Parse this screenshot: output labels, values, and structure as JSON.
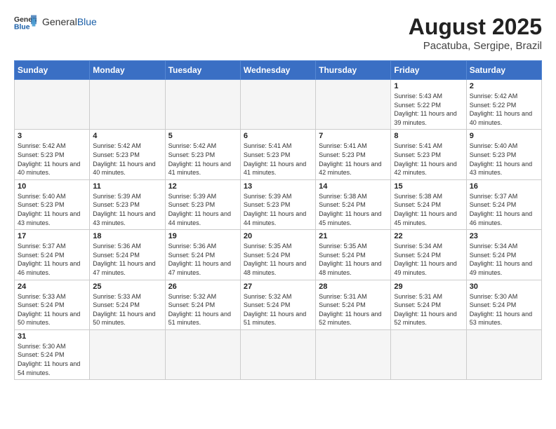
{
  "header": {
    "logo_general": "General",
    "logo_blue": "Blue",
    "title": "August 2025",
    "subtitle": "Pacatuba, Sergipe, Brazil"
  },
  "days_of_week": [
    "Sunday",
    "Monday",
    "Tuesday",
    "Wednesday",
    "Thursday",
    "Friday",
    "Saturday"
  ],
  "weeks": [
    [
      {
        "day": "",
        "info": ""
      },
      {
        "day": "",
        "info": ""
      },
      {
        "day": "",
        "info": ""
      },
      {
        "day": "",
        "info": ""
      },
      {
        "day": "",
        "info": ""
      },
      {
        "day": "1",
        "info": "Sunrise: 5:43 AM\nSunset: 5:22 PM\nDaylight: 11 hours and 39 minutes."
      },
      {
        "day": "2",
        "info": "Sunrise: 5:42 AM\nSunset: 5:22 PM\nDaylight: 11 hours and 40 minutes."
      }
    ],
    [
      {
        "day": "3",
        "info": "Sunrise: 5:42 AM\nSunset: 5:23 PM\nDaylight: 11 hours and 40 minutes."
      },
      {
        "day": "4",
        "info": "Sunrise: 5:42 AM\nSunset: 5:23 PM\nDaylight: 11 hours and 40 minutes."
      },
      {
        "day": "5",
        "info": "Sunrise: 5:42 AM\nSunset: 5:23 PM\nDaylight: 11 hours and 41 minutes."
      },
      {
        "day": "6",
        "info": "Sunrise: 5:41 AM\nSunset: 5:23 PM\nDaylight: 11 hours and 41 minutes."
      },
      {
        "day": "7",
        "info": "Sunrise: 5:41 AM\nSunset: 5:23 PM\nDaylight: 11 hours and 42 minutes."
      },
      {
        "day": "8",
        "info": "Sunrise: 5:41 AM\nSunset: 5:23 PM\nDaylight: 11 hours and 42 minutes."
      },
      {
        "day": "9",
        "info": "Sunrise: 5:40 AM\nSunset: 5:23 PM\nDaylight: 11 hours and 43 minutes."
      }
    ],
    [
      {
        "day": "10",
        "info": "Sunrise: 5:40 AM\nSunset: 5:23 PM\nDaylight: 11 hours and 43 minutes."
      },
      {
        "day": "11",
        "info": "Sunrise: 5:39 AM\nSunset: 5:23 PM\nDaylight: 11 hours and 43 minutes."
      },
      {
        "day": "12",
        "info": "Sunrise: 5:39 AM\nSunset: 5:23 PM\nDaylight: 11 hours and 44 minutes."
      },
      {
        "day": "13",
        "info": "Sunrise: 5:39 AM\nSunset: 5:23 PM\nDaylight: 11 hours and 44 minutes."
      },
      {
        "day": "14",
        "info": "Sunrise: 5:38 AM\nSunset: 5:24 PM\nDaylight: 11 hours and 45 minutes."
      },
      {
        "day": "15",
        "info": "Sunrise: 5:38 AM\nSunset: 5:24 PM\nDaylight: 11 hours and 45 minutes."
      },
      {
        "day": "16",
        "info": "Sunrise: 5:37 AM\nSunset: 5:24 PM\nDaylight: 11 hours and 46 minutes."
      }
    ],
    [
      {
        "day": "17",
        "info": "Sunrise: 5:37 AM\nSunset: 5:24 PM\nDaylight: 11 hours and 46 minutes."
      },
      {
        "day": "18",
        "info": "Sunrise: 5:36 AM\nSunset: 5:24 PM\nDaylight: 11 hours and 47 minutes."
      },
      {
        "day": "19",
        "info": "Sunrise: 5:36 AM\nSunset: 5:24 PM\nDaylight: 11 hours and 47 minutes."
      },
      {
        "day": "20",
        "info": "Sunrise: 5:35 AM\nSunset: 5:24 PM\nDaylight: 11 hours and 48 minutes."
      },
      {
        "day": "21",
        "info": "Sunrise: 5:35 AM\nSunset: 5:24 PM\nDaylight: 11 hours and 48 minutes."
      },
      {
        "day": "22",
        "info": "Sunrise: 5:34 AM\nSunset: 5:24 PM\nDaylight: 11 hours and 49 minutes."
      },
      {
        "day": "23",
        "info": "Sunrise: 5:34 AM\nSunset: 5:24 PM\nDaylight: 11 hours and 49 minutes."
      }
    ],
    [
      {
        "day": "24",
        "info": "Sunrise: 5:33 AM\nSunset: 5:24 PM\nDaylight: 11 hours and 50 minutes."
      },
      {
        "day": "25",
        "info": "Sunrise: 5:33 AM\nSunset: 5:24 PM\nDaylight: 11 hours and 50 minutes."
      },
      {
        "day": "26",
        "info": "Sunrise: 5:32 AM\nSunset: 5:24 PM\nDaylight: 11 hours and 51 minutes."
      },
      {
        "day": "27",
        "info": "Sunrise: 5:32 AM\nSunset: 5:24 PM\nDaylight: 11 hours and 51 minutes."
      },
      {
        "day": "28",
        "info": "Sunrise: 5:31 AM\nSunset: 5:24 PM\nDaylight: 11 hours and 52 minutes."
      },
      {
        "day": "29",
        "info": "Sunrise: 5:31 AM\nSunset: 5:24 PM\nDaylight: 11 hours and 52 minutes."
      },
      {
        "day": "30",
        "info": "Sunrise: 5:30 AM\nSunset: 5:24 PM\nDaylight: 11 hours and 53 minutes."
      }
    ],
    [
      {
        "day": "31",
        "info": "Sunrise: 5:30 AM\nSunset: 5:24 PM\nDaylight: 11 hours and 54 minutes."
      },
      {
        "day": "",
        "info": ""
      },
      {
        "day": "",
        "info": ""
      },
      {
        "day": "",
        "info": ""
      },
      {
        "day": "",
        "info": ""
      },
      {
        "day": "",
        "info": ""
      },
      {
        "day": "",
        "info": ""
      }
    ]
  ]
}
